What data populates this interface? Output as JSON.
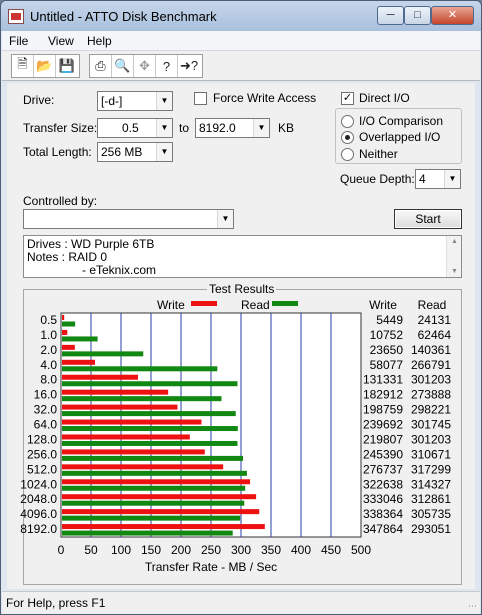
{
  "window": {
    "title": "Untitled - ATTO Disk Benchmark"
  },
  "menu": [
    "File",
    "View",
    "Help"
  ],
  "toolbar": {
    "icons": [
      "new-file-icon",
      "open-folder-icon",
      "save-disk-icon",
      "print-icon",
      "print-preview-icon",
      "move-icon",
      "help-icon",
      "context-help-icon"
    ]
  },
  "settings": {
    "drive_label": "Drive:",
    "drive_value": "[-d-]",
    "force_write_label": "Force Write Access",
    "force_write_checked": false,
    "direct_io_label": "Direct I/O",
    "direct_io_checked": true,
    "transfer_size_label": "Transfer Size:",
    "transfer_from": "0.5",
    "to_label": "to",
    "transfer_to": "8192.0",
    "kb_label": "KB",
    "total_length_label": "Total Length:",
    "total_length_value": "256 MB",
    "io_options": [
      {
        "label": "I/O Comparison",
        "selected": false
      },
      {
        "label": "Overlapped I/O",
        "selected": true
      },
      {
        "label": "Neither",
        "selected": false
      }
    ],
    "queue_depth_label": "Queue Depth:",
    "queue_depth_value": "4",
    "controlled_by_label": "Controlled by:",
    "controlled_by_value": "",
    "start_label": "Start"
  },
  "notes": {
    "line1": "Drives : WD Purple 6TB",
    "line2": "Notes : RAID 0",
    "line3": "- eTeknix.com"
  },
  "results": {
    "title": "Test Results",
    "legend_write": "Write",
    "legend_read": "Read",
    "col_write": "Write",
    "col_read": "Read",
    "write_color": "#ee1111",
    "read_color": "#118811",
    "grid_color": "#2a3fa8"
  },
  "chart_data": {
    "type": "bar",
    "title": "Test Results",
    "xlabel": "Transfer Rate - MB / Sec",
    "ylabel": "",
    "xlim": [
      0,
      500
    ],
    "xticks": [
      0,
      50,
      100,
      150,
      200,
      250,
      300,
      350,
      400,
      450,
      500
    ],
    "categories": [
      "0.5",
      "1.0",
      "2.0",
      "4.0",
      "8.0",
      "16.0",
      "32.0",
      "64.0",
      "128.0",
      "256.0",
      "512.0",
      "1024.0",
      "2048.0",
      "4096.0",
      "8192.0"
    ],
    "series": [
      {
        "name": "Write",
        "raw": [
          5449,
          10752,
          23650,
          58077,
          131331,
          182912,
          198759,
          239692,
          219807,
          245390,
          276737,
          322638,
          333046,
          338364,
          347864
        ],
        "values": [
          5.3,
          10.5,
          23.1,
          56.7,
          128.3,
          178.6,
          194.1,
          234.1,
          214.7,
          239.6,
          270.3,
          315.1,
          325.2,
          330.4,
          339.7
        ]
      },
      {
        "name": "Read",
        "raw": [
          24131,
          62464,
          140361,
          266791,
          301203,
          273888,
          298221,
          301745,
          301203,
          310671,
          317299,
          314327,
          312861,
          305735,
          293051
        ],
        "values": [
          23.6,
          61.0,
          137.1,
          260.5,
          294.1,
          267.5,
          291.2,
          294.7,
          294.1,
          303.4,
          309.9,
          307.0,
          305.5,
          298.6,
          286.2
        ]
      }
    ],
    "grid": true
  },
  "status": {
    "text": "For Help, press F1"
  }
}
